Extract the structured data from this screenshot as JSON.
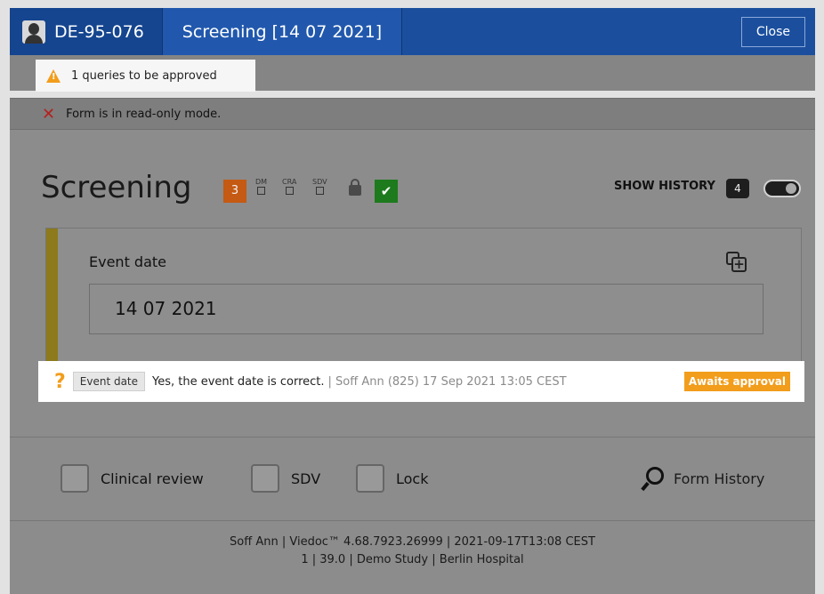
{
  "header": {
    "subject_id": "DE-95-076",
    "form_tab": "Screening [14 07 2021]",
    "close_label": "Close"
  },
  "banners": {
    "queries": "1 queries to be approved",
    "read_only": "Form is in read-only mode."
  },
  "form": {
    "title": "Screening",
    "query_count": "3",
    "flags": [
      "DM",
      "CRA",
      "SDV"
    ],
    "show_history_label": "SHOW HISTORY",
    "history_count": "4"
  },
  "field": {
    "label": "Event date",
    "value": "14 07 2021"
  },
  "query": {
    "field_chip": "Event date",
    "text": "Yes, the event date is correct.",
    "meta": "| Soff Ann (825) 17 Sep 2021 13:05 CEST",
    "status": "Awaits approval"
  },
  "actions": {
    "clinical_review": "Clinical review",
    "sdv": "SDV",
    "lock": "Lock",
    "form_history": "Form History"
  },
  "footer": {
    "line1": "Soff Ann | Viedoc™ 4.68.7923.26999 | 2021-09-17T13:08 CEST",
    "line2": "1 | 39.0 | Demo Study | Berlin Hospital"
  },
  "colors": {
    "brand": "#1b4f9e",
    "warning": "#f29d1b",
    "query_badge": "#c45a13",
    "signed": "#1d7a1d"
  }
}
